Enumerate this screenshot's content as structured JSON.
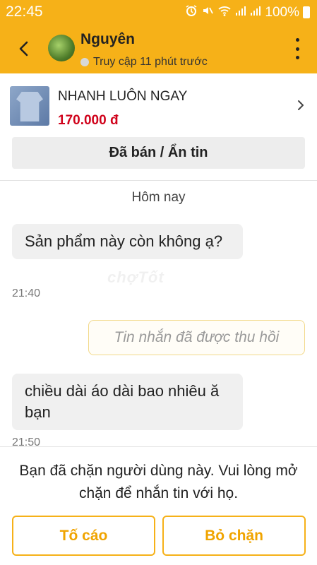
{
  "status_bar": {
    "time": "22:45",
    "battery_percent": "100%",
    "icons": [
      "alarm-icon",
      "mute-icon",
      "wifi-icon",
      "signal-icon",
      "signal-icon",
      "battery-icon"
    ]
  },
  "header": {
    "contact_name": "Nguyên",
    "presence": "Truy cập 11 phút trước"
  },
  "product": {
    "title": "NHANH LUÔN NGAY",
    "price": "170.000 đ",
    "sold_label": "Đã bán / Ẩn tin"
  },
  "chat": {
    "date_separator": "Hôm nay",
    "messages": [
      {
        "direction": "incoming",
        "text": "Sản phẩm này còn không ạ?",
        "time": "21:40"
      },
      {
        "direction": "outgoing",
        "text": "Tin nhắn đã được thu hồi"
      },
      {
        "direction": "incoming",
        "text": "chiều dài áo dài bao nhiêu ă bạn",
        "time": "21:50"
      }
    ]
  },
  "footer": {
    "blocked_message": "Bạn đã chặn người dùng này. Vui lòng mở chặn để nhắn tin với họ.",
    "report_label": "Tố cáo",
    "unblock_label": "Bỏ chặn"
  },
  "colors": {
    "accent": "#f6b118",
    "price": "#d0021b"
  }
}
